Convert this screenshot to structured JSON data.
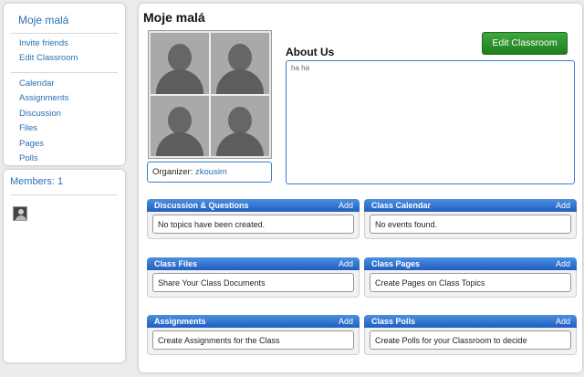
{
  "sidebar": {
    "class_title": "Moje malá",
    "group1": [
      {
        "label": "Invite friends"
      },
      {
        "label": "Edit Classroom"
      }
    ],
    "group2": [
      {
        "label": "Calendar"
      },
      {
        "label": "Assignments"
      },
      {
        "label": "Discussion"
      },
      {
        "label": "Files"
      },
      {
        "label": "Pages"
      },
      {
        "label": "Polls"
      }
    ]
  },
  "members": {
    "title": "Members: 1"
  },
  "main": {
    "title": "Moje malá",
    "edit_button": "Edit Classroom",
    "organizer_label": "Organizer:",
    "organizer_name": "zkousim",
    "about_title": "About Us",
    "about_text": "ha ha"
  },
  "widgets": {
    "discussion": {
      "title": "Discussion & Questions",
      "add": "Add",
      "body": "No topics have been created."
    },
    "calendar": {
      "title": "Class Calendar",
      "add": "Add",
      "body": "No events found."
    },
    "files": {
      "title": "Class Files",
      "add": "Add",
      "body": "Share Your Class Documents"
    },
    "pages": {
      "title": "Class Pages",
      "add": "Add",
      "body": "Create Pages on Class Topics"
    },
    "assignments": {
      "title": "Assignments",
      "add": "Add",
      "body": "Create Assignments for the Class"
    },
    "polls": {
      "title": "Class Polls",
      "add": "Add",
      "body": "Create Polls for your Classroom to decide"
    }
  },
  "colors": {
    "link": "#2a6fb4",
    "widget_header": "#1f5fc0",
    "button_green": "#2a922a"
  }
}
